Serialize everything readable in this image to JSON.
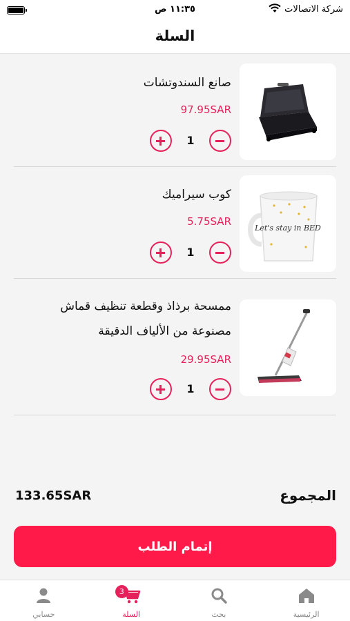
{
  "status_bar": {
    "carrier": "شركة الاتصالات",
    "time": "١١:٣٥ ص"
  },
  "header": {
    "title": "السلة"
  },
  "cart": {
    "items": [
      {
        "name": "صانع السندوتشات",
        "price": "97.95SAR",
        "quantity": "1",
        "image_icon": "sandwich-maker-image"
      },
      {
        "name": "كوب سيراميك",
        "price": "5.75SAR",
        "quantity": "1",
        "image_icon": "ceramic-mug-image",
        "mug_text": "Let's stay in BED"
      },
      {
        "name": "ممسحة برذاذ وقطعة تنظيف قماش مصنوعة من الألياف الدقيقة",
        "price": "29.95SAR",
        "quantity": "1",
        "image_icon": "spray-mop-image"
      }
    ]
  },
  "summary": {
    "total_label": "المجموع",
    "total_value": "133.65SAR"
  },
  "checkout": {
    "label": "إتمام الطلب"
  },
  "tab_bar": {
    "tabs": [
      {
        "label": "الرئيسية",
        "icon": "home-icon"
      },
      {
        "label": "بحث",
        "icon": "search-icon"
      },
      {
        "label": "السلة",
        "icon": "cart-icon",
        "badge": "3",
        "active": true
      },
      {
        "label": "حسابي",
        "icon": "user-icon"
      }
    ]
  },
  "colors": {
    "accent": "#e5215b",
    "button": "#ff1a4a",
    "background": "#f4f4f4"
  }
}
